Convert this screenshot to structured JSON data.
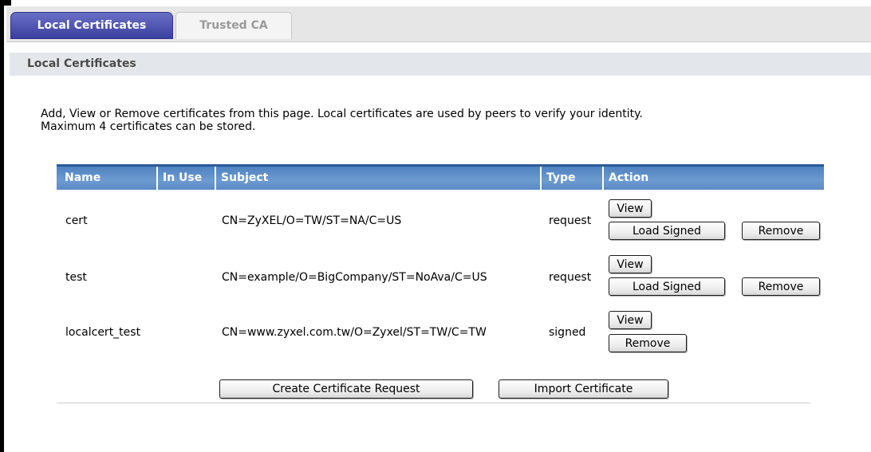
{
  "tabs": [
    {
      "label": "Local Certificates",
      "active": true
    },
    {
      "label": "Trusted CA",
      "active": false
    }
  ],
  "section_title": "Local Certificates",
  "description": {
    "line1": "Add, View or Remove certificates from this page. Local certificates are used by peers to verify your identity.",
    "line2": "Maximum 4 certificates can be stored."
  },
  "table": {
    "headers": [
      "Name",
      "In Use",
      "Subject",
      "Type",
      "Action"
    ],
    "rows": [
      {
        "name": "cert",
        "in_use": "",
        "subject": "CN=ZyXEL/O=TW/ST=NA/C=US",
        "type": "request",
        "actions": {
          "view": "View",
          "load_signed": "Load Signed",
          "remove": "Remove"
        }
      },
      {
        "name": "test",
        "in_use": "",
        "subject": "CN=example/O=BigCompany/ST=NoAva/C=US",
        "type": "request",
        "actions": {
          "view": "View",
          "load_signed": "Load Signed",
          "remove": "Remove"
        }
      },
      {
        "name": "localcert_test",
        "in_use": "",
        "subject": "CN=www.zyxel.com.tw/O=Zyxel/ST=TW/C=TW",
        "type": "signed",
        "actions": {
          "view": "View",
          "remove": "Remove"
        }
      }
    ]
  },
  "buttons": {
    "create_request": "Create Certificate Request",
    "import": "Import Certificate"
  },
  "colors": {
    "tab_active": "#3b3f9e",
    "table_header": "#5a8ac6",
    "section_header_bg": "#e3e7ec"
  }
}
